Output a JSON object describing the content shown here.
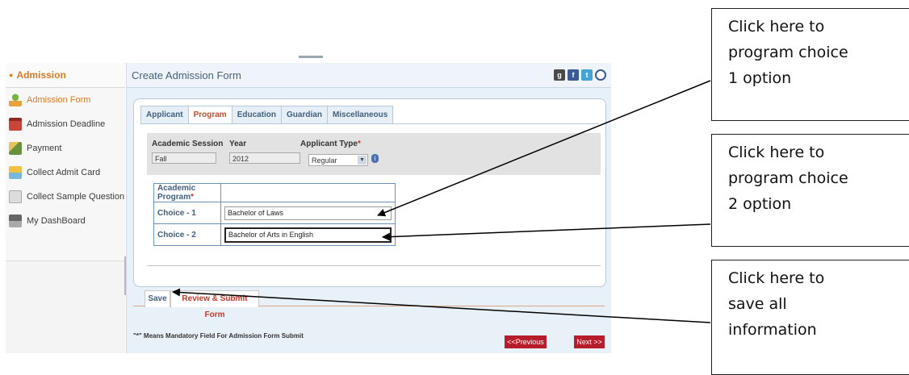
{
  "sidebar": {
    "section_title": "Admission",
    "items": [
      {
        "label": "Admission Form",
        "icon": "admission-form-icon",
        "active": true
      },
      {
        "label": "Admission Deadline",
        "icon": "calendar-icon"
      },
      {
        "label": "Payment",
        "icon": "payment-icon"
      },
      {
        "label": "Collect Admit Card",
        "icon": "admit-card-icon"
      },
      {
        "label": "Collect Sample Question",
        "icon": "question-icon"
      },
      {
        "label": "My DashBoard",
        "icon": "dashboard-icon"
      }
    ]
  },
  "main": {
    "title": "Create Admission Form",
    "social": [
      "g",
      "f",
      "t",
      "o"
    ],
    "tabs": [
      {
        "label": "Applicant"
      },
      {
        "label": "Program",
        "active": true
      },
      {
        "label": "Education"
      },
      {
        "label": "Guardian"
      },
      {
        "label": "Miscellaneous"
      }
    ],
    "session": {
      "academic_session_label": "Academic Session",
      "year_label": "Year",
      "applicant_type_label": "Applicant Type",
      "required_mark": "*",
      "academic_session_value": "Fall",
      "year_value": "2012",
      "applicant_type_value": "Regular"
    },
    "program": {
      "header": "Academic Program",
      "choice1_label": "Choice - 1",
      "choice1_value": "Bachelor of Laws",
      "choice2_label": "Choice - 2",
      "choice2_value": "Bachelor of Arts in English"
    },
    "buttons": {
      "save": "Save",
      "review_submit": "Review & Submit Form",
      "previous": "<<Previous",
      "next": "Next >>"
    },
    "note": "\"*\" Means Mandatory Field For Admission Form Submit"
  },
  "callouts": {
    "choice1": [
      "Click here to",
      "program choice",
      "1 option"
    ],
    "choice2": [
      "Click here to",
      "program choice",
      "2 option"
    ],
    "save": [
      "Click here to",
      "save all",
      "information"
    ]
  },
  "colors": {
    "accent": "#d97a27",
    "tab_active": "#c44c2b",
    "nav_button": "#b71c2c",
    "panel_border": "#b6cade"
  }
}
